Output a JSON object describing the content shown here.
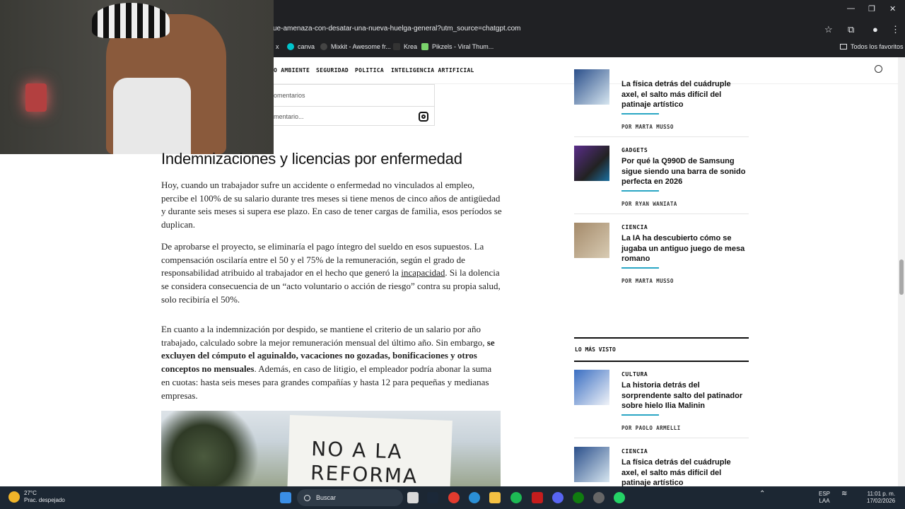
{
  "browser": {
    "url": "ue-amenaza-con-desatar-una-nueva-huelga-general?utm_source=chatgpt.com",
    "bookmarks": [
      {
        "label": "x",
        "icon": ""
      },
      {
        "label": "canva",
        "icon": "canva-icon"
      },
      {
        "label": "Mixkit - Awesome fr...",
        "icon": "mixkit-icon"
      },
      {
        "label": "Krea",
        "icon": "krea-icon"
      },
      {
        "label": "Pikzels - Viral Thum...",
        "icon": "pikzels-icon"
      }
    ],
    "favorites_folder": "Todos los favoritos"
  },
  "nav": {
    "items": [
      "O AMBIENTE",
      "SEGURIDAD",
      "POLITICA",
      "INTELIGENCIA ARTIFICIAL"
    ]
  },
  "embed": {
    "comments_label": "omentarios",
    "comment_placeholder": "mentario..."
  },
  "article": {
    "heading": "Indemnizaciones y licencias por enfermedad",
    "p1": "Hoy, cuando un trabajador sufre un accidente o enfermedad no vinculados al empleo, percibe el 100% de su salario durante tres meses si tiene menos de cinco años de antigüedad y durante seis meses si supera ese plazo. En caso de tener cargas de familia, esos períodos se duplican.",
    "p2_a": "De aprobarse el proyecto, se eliminaría el pago íntegro del sueldo en esos supuestos. La compensación oscilaría entre el 50 y el 75% de la remuneración, según el grado de responsabilidad atribuido al trabajador en el hecho que generó la ",
    "p2_link": "incapacidad",
    "p2_b": ". Si la dolencia se considera consecuencia de un “acto voluntario o acción de riesgo” contra su propia salud, solo recibiría el 50%.",
    "p3_a": "En cuanto a la indemnización por despido, se mantiene el criterio de un salario por año trabajado, calculado sobre la mejor remuneración mensual del último año. Sin embargo, ",
    "p3_bold": "se excluyen del cómputo el aguinaldo, vacaciones no gozadas, bonificaciones y otros conceptos no mensuales",
    "p3_b": ". Además, en caso de litigio, el empleador podría abonar la suma en cuotas: hasta seis meses para grandes compañías y hasta 12 para pequeñas y medianas empresas.",
    "image_sign_line1": "NO A LA",
    "image_sign_line2": "REFORMA"
  },
  "sidebar": {
    "cards": [
      {
        "category": "",
        "title": "La física detrás del cuádruple axel, el salto más difícil del patinaje artístico",
        "byline": "POR MARTA MUSSO"
      },
      {
        "category": "GADGETS",
        "title": "Por qué la Q990D de Samsung sigue siendo una barra de sonido perfecta en 2026",
        "byline": "POR RYAN WANIATA"
      },
      {
        "category": "CIENCIA",
        "title": "La IA ha descubierto cómo se jugaba un antiguo juego de mesa romano",
        "byline": "POR MARTA MUSSO"
      }
    ],
    "most_viewed_label": "LO MÁS VISTO",
    "most_viewed": [
      {
        "category": "CULTURA",
        "title": "La historia detrás del sorprendente salto del patinador sobre hielo Ilia Malinin",
        "byline": "POR PAOLO ARMELLI"
      },
      {
        "category": "CIENCIA",
        "title": "La física detrás del cuádruple axel, el salto más difícil del patinaje artístico",
        "byline": ""
      }
    ]
  },
  "taskbar": {
    "weather_temp": "27°C",
    "weather_desc": "Prac. despejado",
    "search_placeholder": "Buscar",
    "lang1": "ESP",
    "lang2": "LAA",
    "time": "11:01 p. m.",
    "date": "17/02/2026"
  },
  "colors": {
    "accent": "#2aa6c4",
    "chrome_bg": "#202124",
    "taskbar_bg": "#1c2733"
  }
}
